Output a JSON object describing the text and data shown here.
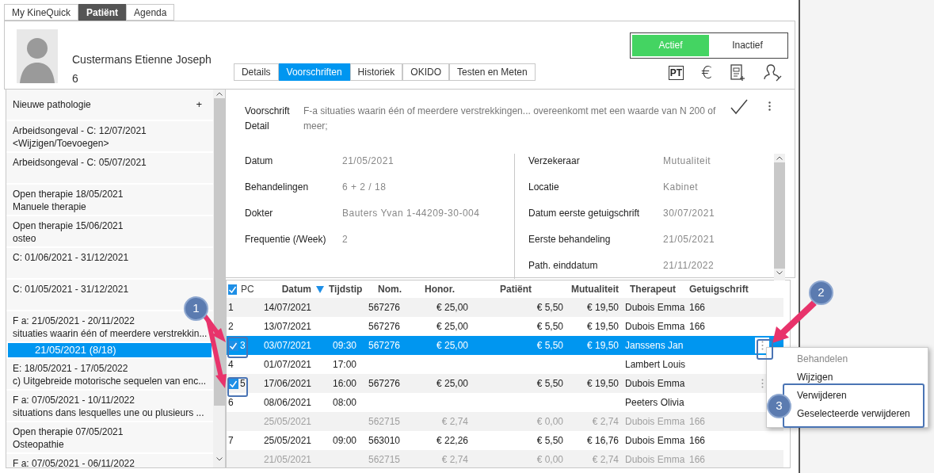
{
  "app_tabs": [
    {
      "label": "My KineQuick",
      "selected": false
    },
    {
      "label": "Patiënt",
      "selected": true
    },
    {
      "label": "Agenda",
      "selected": false
    }
  ],
  "patient": {
    "name": "Custermans Etienne Joseph",
    "number": "6"
  },
  "detail_tabs": [
    {
      "label": "Details",
      "selected": false
    },
    {
      "label": "Voorschriften",
      "selected": true
    },
    {
      "label": "Historiek",
      "selected": false
    },
    {
      "label": "OKIDO",
      "selected": false
    },
    {
      "label": "Testen en Meten",
      "selected": false
    }
  ],
  "status_toggle": [
    {
      "label": "Actief",
      "selected": true
    },
    {
      "label": "Inactief",
      "selected": false
    }
  ],
  "toolbar": {
    "pt_label": "PT",
    "currency_label": "€"
  },
  "sidebar": {
    "new_item": {
      "label": "Nieuwe pathologie",
      "action": "+"
    },
    "items": [
      {
        "lines": [
          "Arbeidsongeval - C: 12/07/2021",
          "<Wijzigen/Toevoegen>"
        ],
        "selected": false
      },
      {
        "lines": [
          "Arbeidsongeval - C: 05/07/2021"
        ],
        "selected": false
      },
      {
        "lines": [
          "Open therapie 18/05/2021",
          "Manuele therapie"
        ],
        "selected": false
      },
      {
        "lines": [
          "Open therapie 15/06/2021",
          "osteo"
        ],
        "selected": false
      },
      {
        "lines": [
          "C: 01/06/2021 - 31/12/2021"
        ],
        "selected": false
      },
      {
        "lines": [
          "C: 01/05/2021 - 31/12/2021"
        ],
        "selected": false
      },
      {
        "lines": [
          "F a: 21/05/2021 - 20/11/2022",
          "situaties waarin één of meerdere verstrekkin..."
        ],
        "selected": false,
        "children": [
          {
            "lines": [
              "21/05/2021  (8/18)"
            ],
            "selected": true
          }
        ]
      },
      {
        "lines": [
          "E: 18/05/2021 - 17/05/2022",
          "c) Uitgebreide motorische sequelen van enc..."
        ],
        "selected": false
      },
      {
        "lines": [
          "F a: 07/05/2021 - 10/11/2022",
          "situations dans lesquelles une ou plusieurs ..."
        ],
        "selected": false
      },
      {
        "lines": [
          "Open therapie 07/05/2021",
          "Osteopathie"
        ],
        "selected": false
      },
      {
        "lines": [
          "F a: 07/05/2021 - 06/11/2022"
        ],
        "selected": false
      }
    ]
  },
  "prescription": {
    "label": "Voorschrift Detail",
    "value": "F-a situaties waarin één of meerdere verstrekkingen... overeenkomt met een waarde van N 200 of meer;"
  },
  "details_left": [
    {
      "label": "Datum",
      "value": "21/05/2021"
    },
    {
      "label": "Behandelingen",
      "value": "6 + 2 / 18"
    },
    {
      "label": "Dokter",
      "value": "Bauters Yvan 1-44209-30-004"
    },
    {
      "label": "Frequentie (/Week)",
      "value": "2"
    }
  ],
  "details_right": [
    {
      "label": "Verzekeraar",
      "value": "Mutualiteit"
    },
    {
      "label": "Locatie",
      "value": "Kabinet"
    },
    {
      "label": "Datum eerste getuigschrift",
      "value": "30/07/2021"
    },
    {
      "label": "Eerste behandeling",
      "value": "21/05/2021"
    },
    {
      "label": "Path. einddatum",
      "value": "21/11/2022"
    }
  ],
  "table": {
    "select_all_checked": true,
    "columns": [
      {
        "label": "PC",
        "sorted": false
      },
      {
        "label": "Datum",
        "sorted": true
      },
      {
        "label": "Tijdstip",
        "sorted": false
      },
      {
        "label": "Nom.",
        "sorted": false
      },
      {
        "label": "Honor.",
        "sorted": false
      },
      {
        "label": "Patiënt",
        "sorted": false
      },
      {
        "label": "Mutualiteit",
        "sorted": false
      },
      {
        "label": "Therapeut",
        "sorted": false
      },
      {
        "label": "Getuigschrift",
        "sorted": false
      }
    ],
    "rows": [
      {
        "pc": "1",
        "checked": false,
        "selected": false,
        "dimmed": false,
        "menu": false,
        "date": "14/07/2021",
        "nom": "567276",
        "honor": "€ 25,00",
        "patient": "€ 5,50",
        "mutual": "€ 19,50",
        "therapist": "Dubois Emma",
        "cert": "166"
      },
      {
        "pc": "2",
        "checked": false,
        "selected": false,
        "dimmed": false,
        "menu": false,
        "date": "13/07/2021",
        "nom": "567276",
        "honor": "€ 25,00",
        "patient": "€ 5,50",
        "mutual": "€ 19,50",
        "therapist": "Dubois Emma",
        "cert": "166"
      },
      {
        "pc": "3",
        "checked": true,
        "selected": true,
        "dimmed": false,
        "menu": true,
        "date": "03/07/2021",
        "time": "09:30",
        "nom": "567276",
        "honor": "€ 25,00",
        "patient": "€ 5,50",
        "mutual": "€ 19,50",
        "therapist": "Janssens Jan"
      },
      {
        "pc": "4",
        "checked": false,
        "selected": false,
        "dimmed": false,
        "menu": false,
        "date": "01/07/2021",
        "time": "17:00",
        "therapist": "Lambert Louis"
      },
      {
        "pc": "5",
        "checked": true,
        "selected": false,
        "dimmed": false,
        "menu": true,
        "date": "17/06/2021",
        "time": "16:00",
        "nom": "567276",
        "honor": "€ 25,00",
        "patient": "€ 5,50",
        "mutual": "€ 19,50",
        "therapist": "Dubois Emma"
      },
      {
        "pc": "6",
        "checked": false,
        "selected": false,
        "dimmed": false,
        "menu": false,
        "date": "08/06/2021",
        "time": "08:00",
        "therapist": "Peeters Olivia"
      },
      {
        "checked": false,
        "selected": false,
        "dimmed": true,
        "menu": false,
        "date": "25/05/2021",
        "nom": "562715",
        "honor": "€ 2,74",
        "patient": "€ 0,00",
        "mutual": "€ 2,74",
        "therapist": "Dubois Emma",
        "cert": "166"
      },
      {
        "pc": "7",
        "checked": false,
        "selected": false,
        "dimmed": false,
        "menu": false,
        "date": "25/05/2021",
        "time": "09:00",
        "nom": "563010",
        "honor": "€ 22,26",
        "patient": "€ 5,50",
        "mutual": "€ 16,76",
        "therapist": "Dubois Emma",
        "cert": "166"
      },
      {
        "checked": false,
        "selected": false,
        "dimmed": true,
        "menu": false,
        "date": "21/05/2021",
        "nom": "562715",
        "honor": "€ 2,74",
        "patient": "€ 0,00",
        "mutual": "€ 2,74",
        "therapist": "Dubois Emma",
        "cert": "166"
      }
    ]
  },
  "context_menu": {
    "items": [
      {
        "label": "Behandelen",
        "disabled": true
      },
      {
        "label": "Wijzigen",
        "disabled": false
      },
      {
        "label": "Verwijderen",
        "disabled": false
      },
      {
        "label": "Geselecteerde verwijderen",
        "disabled": false
      }
    ]
  },
  "callouts": [
    {
      "label": "1"
    },
    {
      "label": "2"
    },
    {
      "label": "3"
    }
  ]
}
